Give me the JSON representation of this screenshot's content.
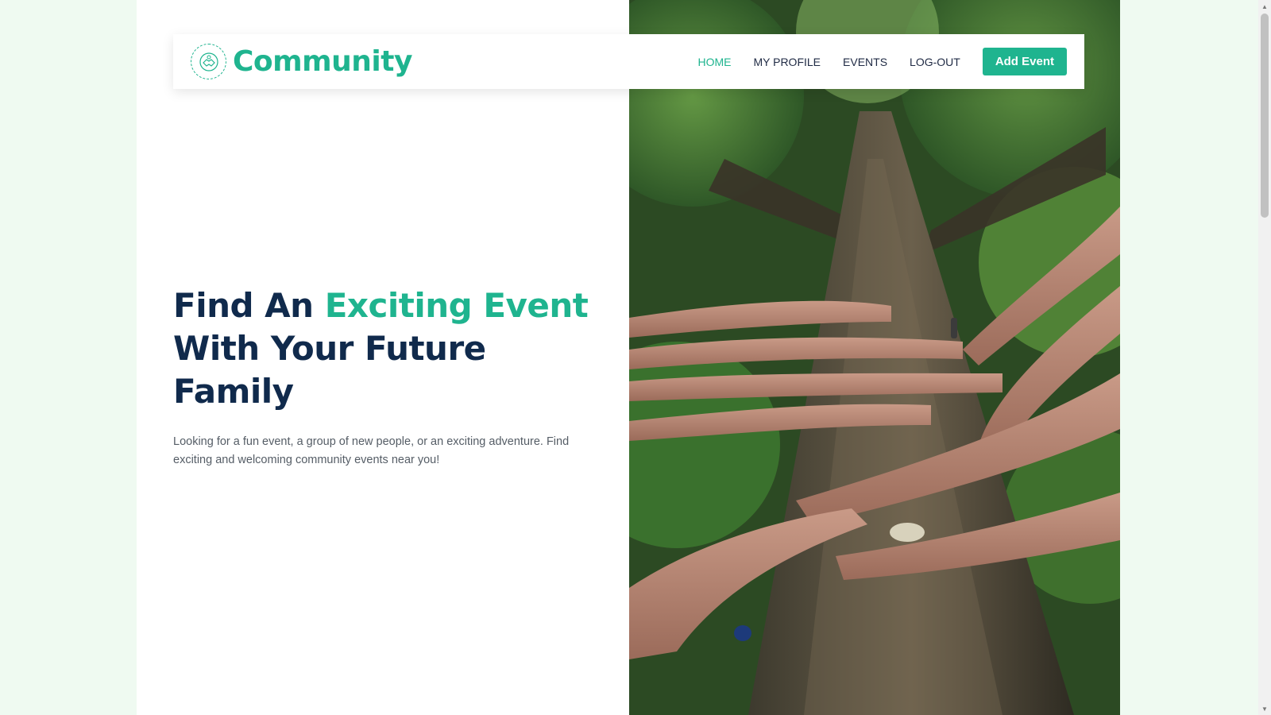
{
  "brand": {
    "name": "Community",
    "logo_icon": "handshake-icon"
  },
  "nav": {
    "home": "HOME",
    "profile": "MY PROFILE",
    "events": "EVENTS",
    "logout": "LOG-OUT",
    "add_event": "Add Event"
  },
  "hero": {
    "title_part1": "Find An ",
    "title_accent": "Exciting Event",
    "title_part2": " With Your Future Family",
    "description": "Looking for a fun event, a group of new people, or an exciting adventure. Find exciting and welcoming community events near you!"
  },
  "colors": {
    "accent": "#1fb48f",
    "heading": "#102a4c",
    "page_background": "#effaf1"
  }
}
